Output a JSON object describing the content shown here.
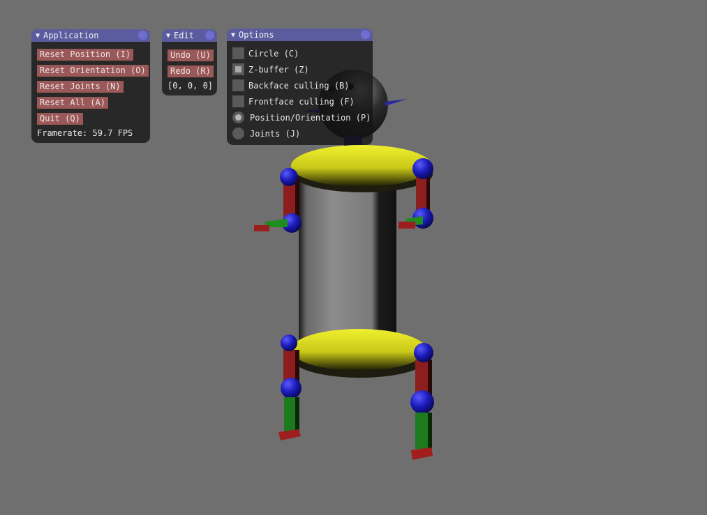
{
  "application": {
    "title": "Application",
    "buttons": [
      "Reset Position (I)",
      "Reset Orientation (O)",
      "Reset Joints (N)",
      "Reset All (A)",
      "Quit (Q)"
    ],
    "framerate": "Framerate: 59.7 FPS"
  },
  "edit": {
    "title": "Edit",
    "undo": "Undo (U)",
    "redo": "Redo (R)",
    "vector": "[0, 0, 0]"
  },
  "options": {
    "title": "Options",
    "checkboxes": [
      {
        "label": "Circle (C)",
        "checked": false
      },
      {
        "label": "Z-buffer (Z)",
        "checked": true
      },
      {
        "label": "Backface culling (B)",
        "checked": false
      },
      {
        "label": "Frontface culling (F)",
        "checked": false
      }
    ],
    "radios": [
      {
        "label": "Position/Orientation (P)",
        "selected": true
      },
      {
        "label": "Joints (J)",
        "selected": false
      }
    ]
  },
  "colors": {
    "background": "#6f6f6f",
    "titlebar": "#5b5ba0",
    "button": "#9a5858",
    "torso_disc": "#e6e61e",
    "joint": "#1e1ecc",
    "upper_limb": "#8c1e1e",
    "lower_limb": "#1e7a1e"
  }
}
